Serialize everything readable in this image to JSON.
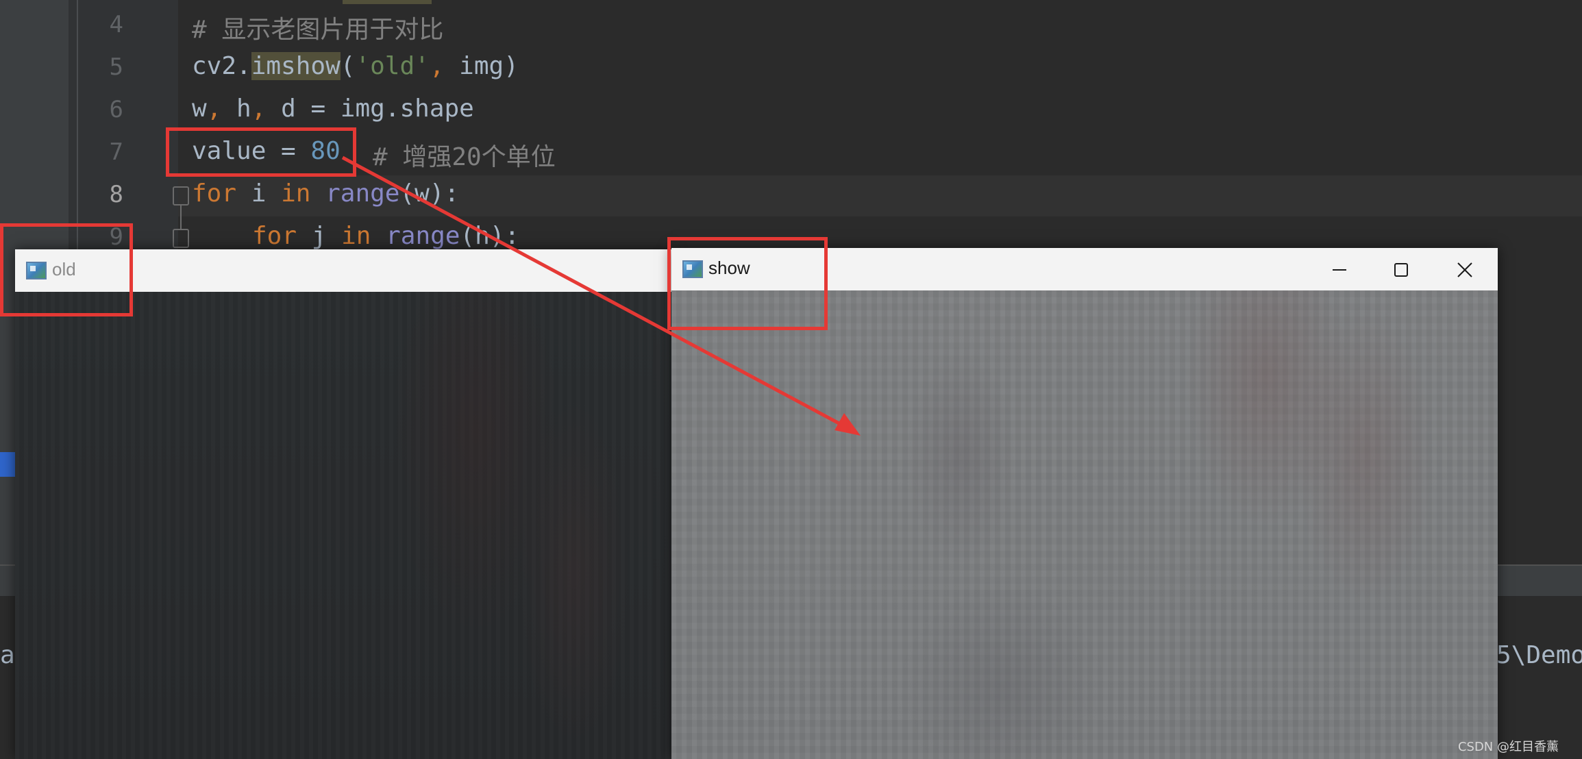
{
  "editor": {
    "lines": [
      {
        "num": "4",
        "comment": "# 显示老图片用于对比"
      },
      {
        "num": "5",
        "fn_prefix": "cv2.",
        "fn": "imshow",
        "open": "(",
        "str": "'old'",
        "comma": ",",
        "arg": " img)"
      },
      {
        "num": "6",
        "p1": "w",
        "c1": ",",
        "p2": " h",
        "c2": ",",
        "p3": " d = img.shape"
      },
      {
        "num": "7",
        "var": "value = ",
        "num_value": "80",
        "comment": "# 增强20个单位"
      },
      {
        "num": "8",
        "kw_for": "for",
        "mid": " i ",
        "kw_in": "in",
        "builtin": "range",
        "rest": "(w):"
      },
      {
        "num": "9",
        "kw_for": "for",
        "mid": " j ",
        "kw_in": "in",
        "builtin": "range",
        "rest": "(h):"
      }
    ],
    "current_line": "8",
    "console_left": "a",
    "console_right": "5\\Demo"
  },
  "windows": [
    {
      "id": "old",
      "title": "old"
    },
    {
      "id": "show",
      "title": "show"
    }
  ],
  "controls": {
    "minimize": "minimize-icon",
    "maximize": "maximize-icon",
    "close": "close-icon"
  },
  "annotation_color": "#e53935",
  "watermark": "CSDN @红目香薰"
}
